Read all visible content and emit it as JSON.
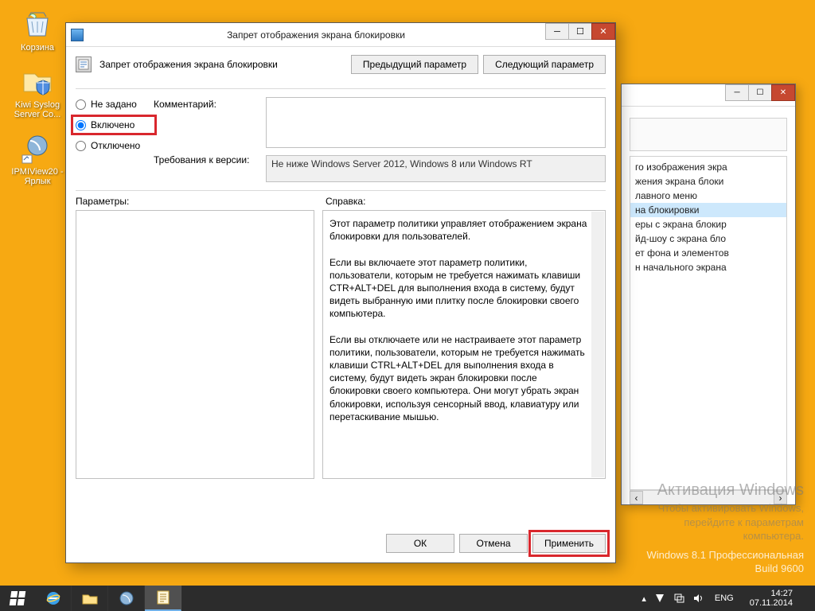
{
  "desktop": {
    "icons": [
      {
        "name": "recycle-bin",
        "label": "Корзина"
      },
      {
        "name": "kiwi-syslog",
        "label": "Kiwi Syslog Server Co..."
      },
      {
        "name": "ipmiview",
        "label": "IPMIView20 - Ярлык"
      }
    ]
  },
  "bg_window": {
    "items": [
      "го изображения экра",
      "жения экрана блоки",
      "лавного меню",
      "на блокировки",
      "еры с экрана блокир",
      "йд-шоу с экрана бло",
      "ет фона и элементов",
      "н начального экрана"
    ],
    "selected_index": 3
  },
  "dialog": {
    "title": "Запрет отображения экрана блокировки",
    "header_text": "Запрет отображения экрана блокировки",
    "nav": {
      "prev": "Предыдущий параметр",
      "next": "Следующий параметр"
    },
    "radios": {
      "not_configured": "Не задано",
      "enabled": "Включено",
      "disabled": "Отключено",
      "selected": "enabled"
    },
    "labels": {
      "comment": "Комментарий:",
      "requirement": "Требования к версии:",
      "parameters": "Параметры:",
      "help": "Справка:"
    },
    "comment_value": "",
    "requirement_text": "Не ниже Windows Server 2012, Windows 8 или Windows RT",
    "help_text": "Этот параметр политики управляет отображением экрана блокировки для пользователей.\n\nЕсли вы включаете этот параметр политики, пользователи, которым не требуется нажимать клавиши CTR+ALT+DEL для выполнения входа в систему, будут видеть выбранную ими плитку после блокировки своего компьютера.\n\nЕсли вы отключаете или не настраиваете этот параметр политики, пользователи, которым не требуется нажимать клавиши CTRL+ALT+DEL для выполнения входа в систему, будут видеть экран блокировки после блокировки своего компьютера. Они могут убрать экран блокировки, используя сенсорный ввод, клавиатуру или перетаскивание мышью.",
    "buttons": {
      "ok": "ОК",
      "cancel": "Отмена",
      "apply": "Применить"
    }
  },
  "watermark": {
    "title": "Активация Windows",
    "line1": "Чтобы активировать Windows,",
    "line2": "перейдите к параметрам",
    "line3": "компьютера.",
    "build1": "Windows 8.1 Профессиональная",
    "build2": "Build 9600"
  },
  "taskbar": {
    "lang": "ENG",
    "time": "14:27",
    "date": "07.11.2014"
  }
}
